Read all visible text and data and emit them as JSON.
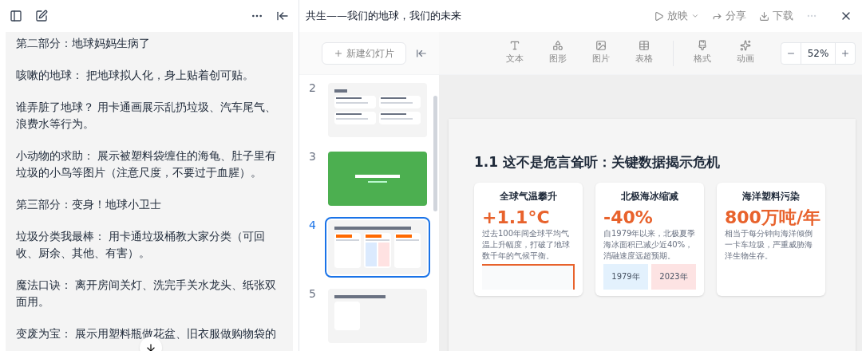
{
  "notes_panel": {
    "paragraphs": [
      "第二部分：地球妈妈生病了",
      "咳嗽的地球： 把地球拟人化，身上贴着创可贴。",
      "谁弄脏了地球？ 用卡通画展示乱扔垃圾、汽车尾气、浪费水等行为。",
      "小动物的求助： 展示被塑料袋缠住的海龟、肚子里有垃圾的小鸟等图片（注意尺度，不要过于血腥）。",
      "第三部分：变身！地球小卫士",
      "垃圾分类我最棒： 用卡通垃圾桶教大家分类（可回收、厨余、其他、有害）。",
      "魔法口诀： 离开房间关灯、洗完手关水龙头、纸张双面用。",
      "变废为宝： 展示用塑料瓶做花盆、旧衣服做购物袋的"
    ]
  },
  "document": {
    "title": "共生——我们的地球，我们的未来",
    "actions": [
      {
        "kind": "play",
        "label": "放映",
        "disabled": true
      },
      {
        "kind": "share",
        "label": "分享",
        "disabled": true
      },
      {
        "kind": "download",
        "label": "下载",
        "disabled": true
      }
    ]
  },
  "toolbar": {
    "new_slide": {
      "label": "新建幻灯片",
      "disabled": true
    },
    "tools": [
      {
        "kind": "text",
        "label": "文本",
        "disabled": true
      },
      {
        "kind": "shape",
        "label": "图形",
        "disabled": true
      },
      {
        "kind": "image",
        "label": "图片",
        "disabled": true
      },
      {
        "kind": "table",
        "label": "表格",
        "disabled": true
      },
      {
        "kind": "format",
        "label": "格式",
        "disabled": true
      },
      {
        "kind": "animation",
        "label": "动画",
        "disabled": true
      }
    ],
    "zoom": "52%"
  },
  "slides": [
    {
      "number": "2",
      "kind": "toc",
      "selected": false
    },
    {
      "number": "3",
      "kind": "section",
      "selected": false
    },
    {
      "number": "4",
      "kind": "data",
      "selected": true
    },
    {
      "number": "5",
      "kind": "content",
      "selected": false
    }
  ],
  "current_slide": {
    "title": "1.1 这不是危言耸听：关键数据揭示危机",
    "cards": [
      {
        "kind": "line",
        "heading": "全球气温攀升",
        "figure": "+1.1°C",
        "text": "过去100年间全球平均气温上升幅度，打破了地球数千年的气候平衡。"
      },
      {
        "kind": "compare",
        "heading": "北极海冰缩减",
        "figure": "-40%",
        "text": "自1979年以来，北极夏季海冰面积已减少近40%，消融速度远超预期。",
        "labels": [
          "1979年",
          "2023年"
        ]
      },
      {
        "kind": "plain",
        "heading": "海洋塑料污染",
        "figure": "800万吨/年",
        "text": "相当于每分钟向海洋倾倒一卡车垃圾，严重威胁海洋生物生存。"
      }
    ]
  }
}
